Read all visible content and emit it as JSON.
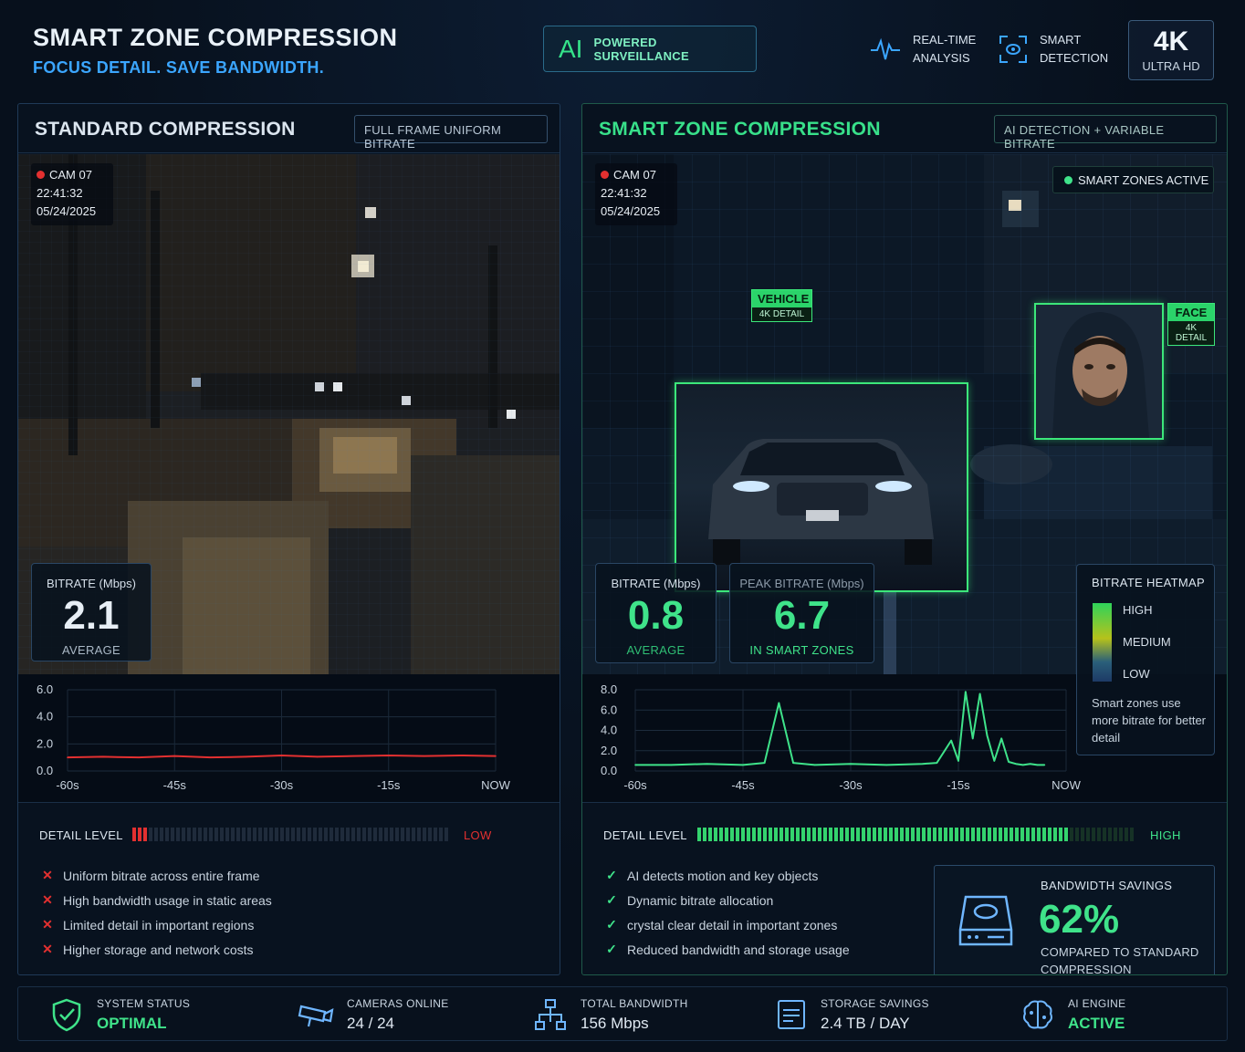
{
  "header": {
    "title": "SMART ZONE COMPRESSION",
    "subtitle": "FOCUS DETAIL. SAVE BANDWIDTH.",
    "badge_mark": "AI",
    "badge_text": "POWERED SURVEILLANCE",
    "feature_1_line1": "REAL-TIME",
    "feature_1_line2": "ANALYSIS",
    "feature_2_line1": "SMART",
    "feature_2_line2": "DETECTION",
    "resolution": "4K",
    "resolution_caption": "ULTRA HD"
  },
  "left": {
    "title": "STANDARD COMPRESSION",
    "tag": "FULL FRAME UNIFORM BITRATE",
    "cam": "CAM 07",
    "time": "22:41:32",
    "date": "05/24/2025",
    "bitrate_label": "BITRATE (Mbps)",
    "bitrate_value": "2.1",
    "bitrate_caption": "AVERAGE",
    "detail_label": "DETAIL LEVEL",
    "detail_value": "LOW",
    "detail_fraction": 0.05,
    "bullets": [
      "Uniform bitrate across entire frame",
      "High bandwidth usage in static areas",
      "Limited detail in important regions",
      "Higher storage and network costs"
    ]
  },
  "right": {
    "title": "SMART ZONE COMPRESSION",
    "tag": "AI DETECTION + VARIABLE BITRATE",
    "cam": "CAM 07",
    "time": "22:41:32",
    "date": "05/24/2025",
    "zones_status": "SMART ZONES ACTIVE",
    "vehicle_tag": "VEHICLE",
    "vehicle_detail": "4K DETAIL",
    "face_tag": "FACE",
    "face_detail": "4K DETAIL",
    "bitrate_label": "BITRATE (Mbps)",
    "bitrate_value": "0.8",
    "bitrate_caption": "AVERAGE",
    "peak_label": "PEAK BITRATE (Mbps)",
    "peak_value": "6.7",
    "peak_caption": "IN SMART ZONES",
    "heatmap_title": "BITRATE HEATMAP",
    "heatmap_high": "HIGH",
    "heatmap_medium": "MEDIUM",
    "heatmap_low": "LOW",
    "heatmap_note": "Smart zones use more bitrate for better detail",
    "detail_label": "DETAIL LEVEL",
    "detail_value": "HIGH",
    "detail_fraction": 0.85,
    "bullets": [
      "AI detects motion and key objects",
      "Dynamic bitrate allocation",
      "crystal clear detail in important zones",
      "Reduced bandwidth and storage usage"
    ],
    "savings_label": "BANDWIDTH SAVINGS",
    "savings_value": "62%",
    "savings_caption": "COMPARED TO STANDARD COMPRESSION"
  },
  "footer": {
    "system_status_label": "SYSTEM STATUS",
    "system_status_value": "OPTIMAL",
    "cameras_label": "CAMERAS ONLINE",
    "cameras_value": "24 / 24",
    "bandwidth_label": "TOTAL BANDWIDTH",
    "bandwidth_value": "156 Mbps",
    "storage_label": "STORAGE SAVINGS",
    "storage_value": "2.4 TB / DAY",
    "ai_label": "AI ENGINE",
    "ai_value": "ACTIVE"
  },
  "colors": {
    "accent_green": "#3fe38a",
    "accent_blue": "#3ba6ff",
    "alert_red": "#e33030"
  },
  "chart_data": [
    {
      "type": "line",
      "ylim": [
        0,
        6
      ],
      "yticks": [
        "6.0",
        "4.0",
        "2.0",
        "0.0"
      ],
      "xticks": [
        "-60s",
        "-45s",
        "-30s",
        "-15s",
        "NOW"
      ],
      "x": [
        -60,
        -55,
        -50,
        -45,
        -40,
        -35,
        -30,
        -25,
        -20,
        -15,
        -10,
        -5,
        0
      ],
      "series": [
        {
          "values": [
            1.0,
            1.05,
            1.0,
            1.1,
            1.0,
            1.05,
            1.15,
            1.05,
            1.1,
            1.15,
            1.1,
            1.15,
            1.1
          ]
        }
      ]
    },
    {
      "type": "line",
      "ylim": [
        0,
        8
      ],
      "yticks": [
        "8.0",
        "6.0",
        "4.0",
        "2.0",
        "0.0"
      ],
      "xticks": [
        "-60s",
        "-45s",
        "-30s",
        "-15s",
        "NOW"
      ],
      "x": [
        -60,
        -55,
        -50,
        -45,
        -42,
        -40,
        -38,
        -35,
        -30,
        -25,
        -20,
        -18,
        -16,
        -15,
        -14,
        -13,
        -12,
        -11,
        -10,
        -9,
        -8,
        -7,
        -6,
        -5,
        -4,
        -3
      ],
      "series": [
        {
          "values": [
            0.6,
            0.6,
            0.7,
            0.6,
            0.8,
            6.7,
            0.8,
            0.6,
            0.7,
            0.6,
            0.7,
            0.8,
            3.0,
            1.0,
            7.8,
            3.2,
            7.6,
            3.5,
            1.0,
            3.2,
            0.9,
            0.7,
            0.6,
            0.7,
            0.6,
            0.6
          ]
        }
      ]
    }
  ]
}
